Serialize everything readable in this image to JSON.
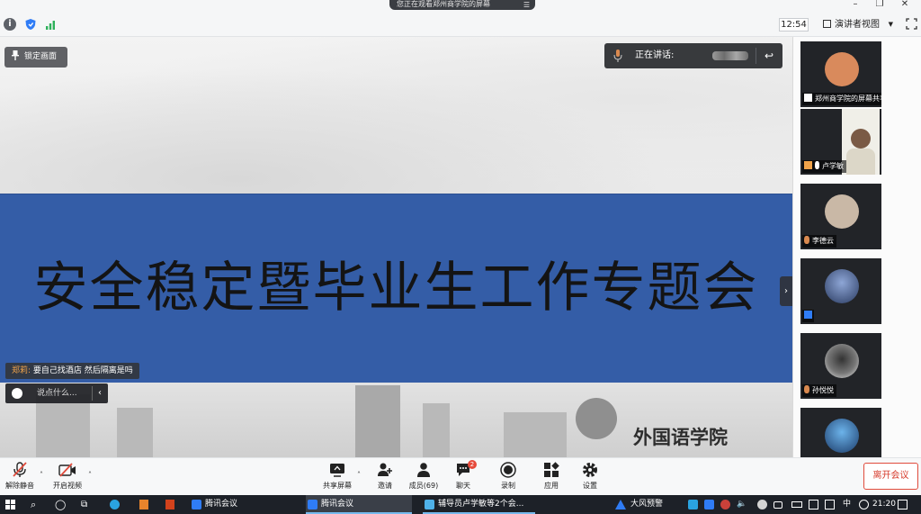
{
  "window": {
    "notice": "您正在观看郑州商学院的屏幕",
    "clock": "12:54",
    "view_mode_label": "演讲者视图"
  },
  "stage": {
    "pin_label": "锁定画面",
    "speaking_label": "正在讲话:",
    "banner_title": "安全稳定暨毕业生工作专题会",
    "college": "外国语学院",
    "chat": {
      "sender": "郑莉:",
      "message": "要自己找酒店  然后隔离是吗"
    },
    "chat_placeholder": "说点什么...",
    "side_toggle": "›"
  },
  "participants": [
    {
      "name": "郑州商学院的屏幕共享",
      "avatar_color": "#d98a5c"
    },
    {
      "name": "卢学敏",
      "avatar_color": "#e7c4a8"
    },
    {
      "name": "李德云",
      "avatar_color": "#c9b8a6"
    },
    {
      "name": "",
      "avatar_color": "#4c5f86"
    },
    {
      "name": "孙悦悦",
      "avatar_color": "#eaeaea"
    },
    {
      "name": "",
      "avatar_color": "#3c82c4"
    }
  ],
  "toolbar": {
    "unmute": "解除静音",
    "start_video": "开启视频",
    "share_screen": "共享屏幕",
    "invite": "邀请",
    "members": "成员(69)",
    "chat": "聊天",
    "chat_badge": "2",
    "record": "录制",
    "apps": "应用",
    "settings": "设置",
    "leave": "离开会议"
  },
  "taskbar": {
    "app1": "腾讯会议",
    "app2": "腾讯会议",
    "app3": "辅导员卢学敏等2个会...",
    "weather": "大风预警",
    "ime": "中",
    "time": "21:20"
  },
  "colors": {
    "banner": "#345da7",
    "leave": "#d63b2c",
    "accent": "#2f7cf6"
  }
}
